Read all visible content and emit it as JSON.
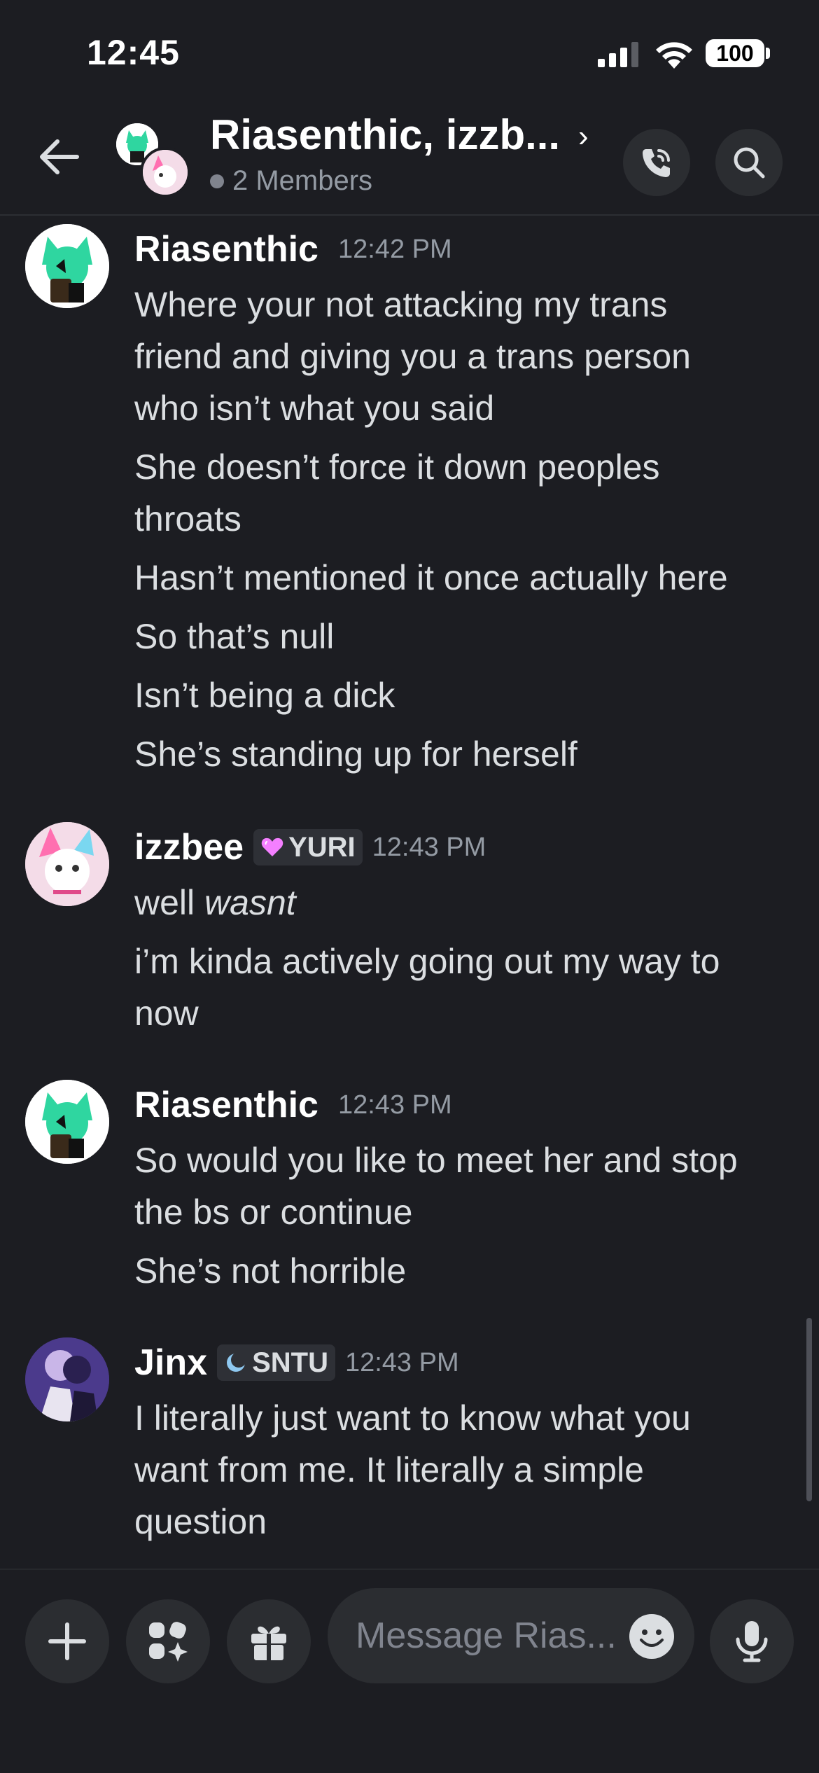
{
  "status_bar": {
    "time": "12:45",
    "battery": "100"
  },
  "header": {
    "title": "Riasenthic, izzb...",
    "members": "2 Members"
  },
  "messages": [
    {
      "user": "Riasenthic",
      "time": "12:42 PM",
      "lines": [
        "Where your not attacking my trans",
        "friend and giving you a trans person",
        "who isn’t what you said",
        "She doesn’t force it down peoples",
        "throats",
        "Hasn’t mentioned it once actually here",
        "So that’s null",
        "Isn’t being a dick",
        "She’s standing up for herself"
      ]
    },
    {
      "user": "izzbee",
      "tag": "YURI",
      "time": "12:43 PM",
      "line0_plain": "well ",
      "line0_em": "wasnt",
      "lines": [
        "i’m kinda actively going out my way to",
        "now"
      ]
    },
    {
      "user": "Riasenthic",
      "time": "12:43 PM",
      "lines": [
        "So would you like to meet her and stop",
        "the bs or continue",
        "She’s not horrible"
      ]
    },
    {
      "user": "Jinx",
      "tag": "SNTU",
      "time": "12:43 PM",
      "lines": [
        "I literally just want to know what you",
        "want from me. It literally a simple",
        "question"
      ]
    }
  ],
  "composer": {
    "placeholder": "Message Rias..."
  },
  "icons": {
    "back": "arrow-left-icon",
    "call": "phone-call-icon",
    "search": "search-icon",
    "add": "plus-icon",
    "apps": "apps-sparkle-icon",
    "gift": "gift-icon",
    "emoji": "emoji-icon",
    "mic": "microphone-icon"
  },
  "colors": {
    "background": "#1c1d22",
    "surface": "#2b2d31",
    "text": "#dbdee1",
    "muted": "#949ba4",
    "tag_heart": "#f47fff"
  }
}
